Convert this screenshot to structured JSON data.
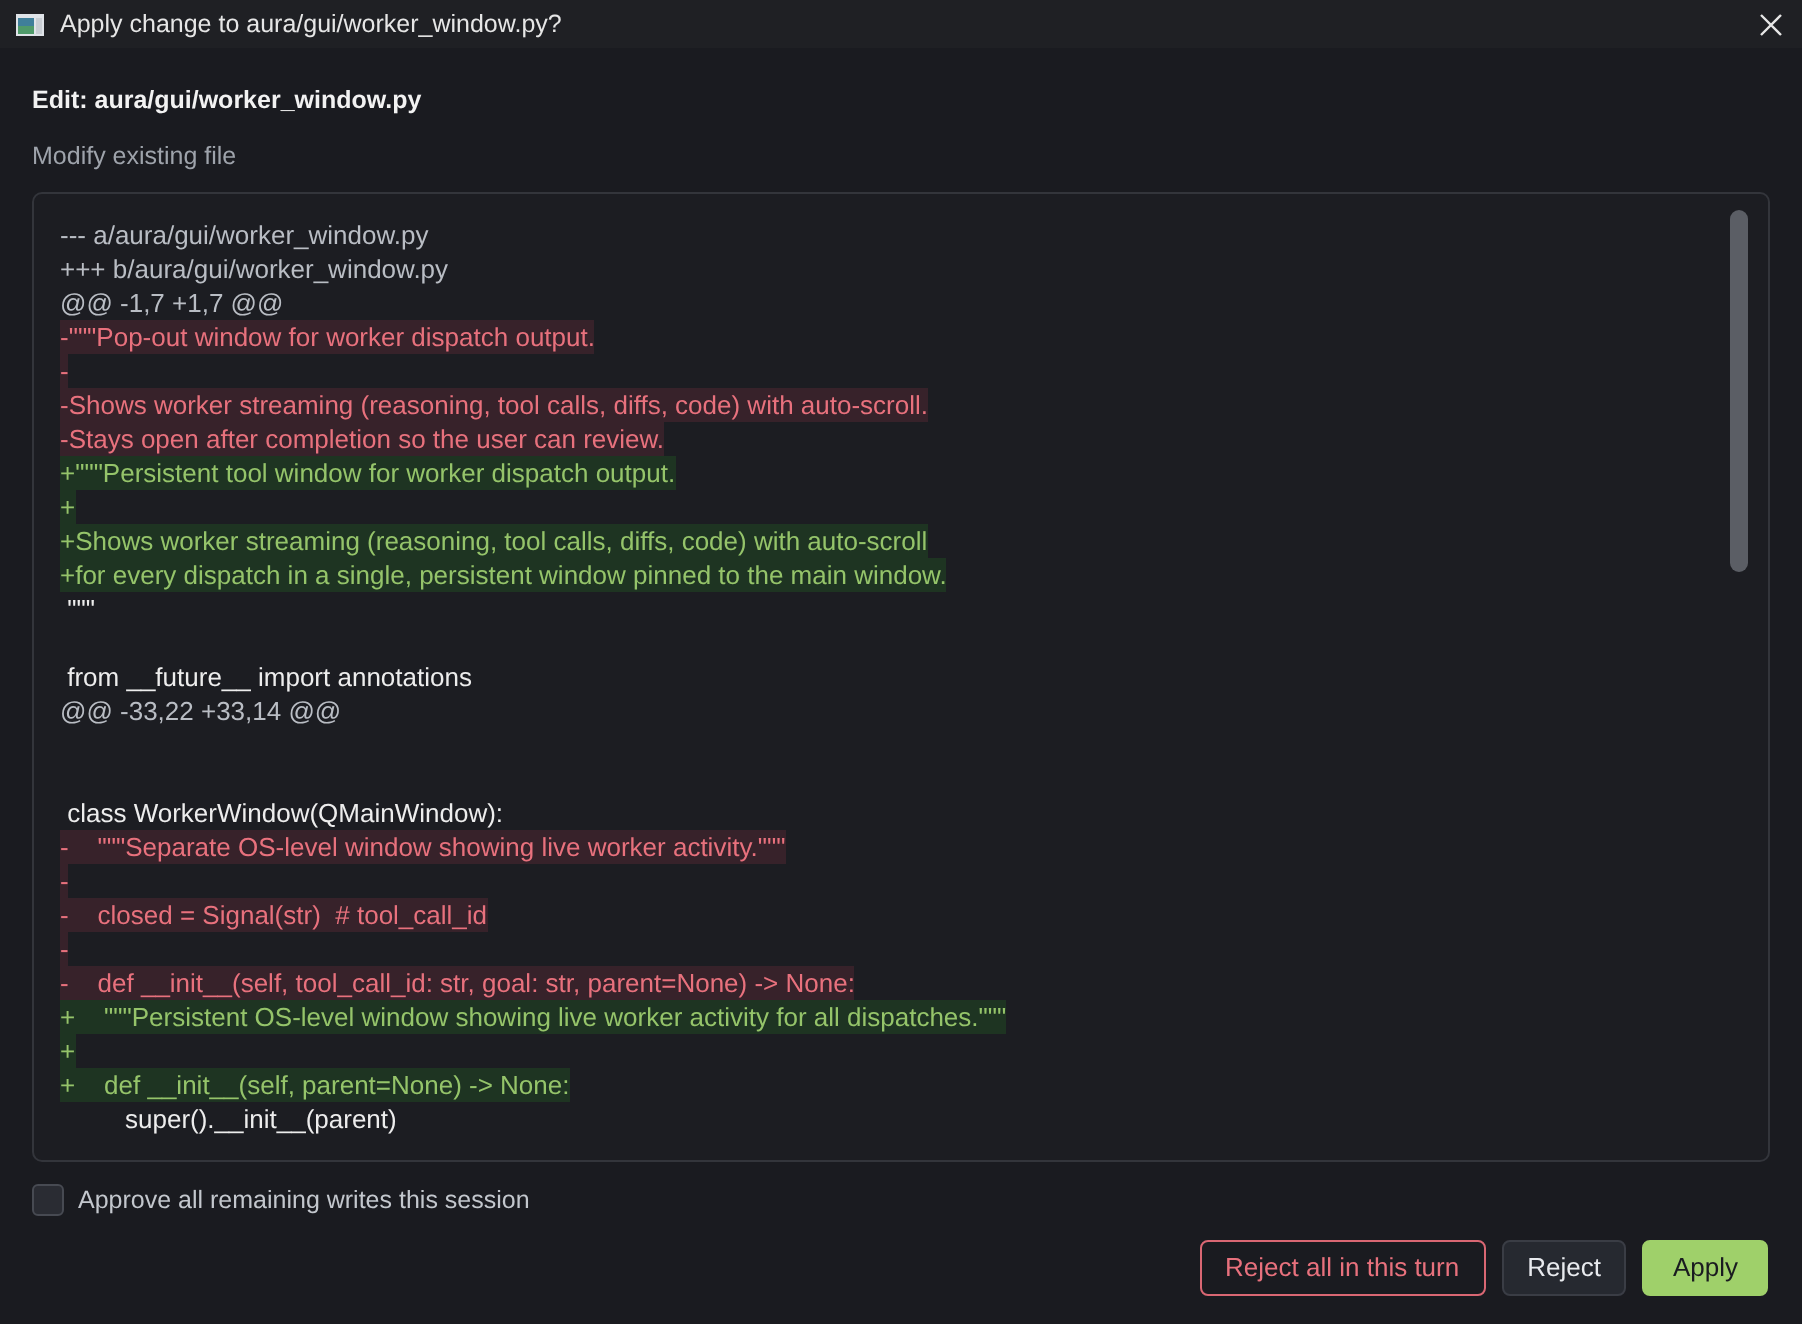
{
  "window": {
    "title": "Apply change to aura/gui/worker_window.py?"
  },
  "heading": "Edit: aura/gui/worker_window.py",
  "subheading": "Modify existing file",
  "diff": {
    "lines": [
      {
        "kind": "header",
        "text": "--- a/aura/gui/worker_window.py"
      },
      {
        "kind": "header",
        "text": "+++ b/aura/gui/worker_window.py"
      },
      {
        "kind": "hunk",
        "text": "@@ -1,7 +1,7 @@"
      },
      {
        "kind": "removed",
        "text": "-\"\"\"Pop-out window for worker dispatch output."
      },
      {
        "kind": "removed",
        "text": "-"
      },
      {
        "kind": "removed",
        "text": "-Shows worker streaming (reasoning, tool calls, diffs, code) with auto-scroll."
      },
      {
        "kind": "removed",
        "text": "-Stays open after completion so the user can review."
      },
      {
        "kind": "added",
        "text": "+\"\"\"Persistent tool window for worker dispatch output."
      },
      {
        "kind": "added",
        "text": "+"
      },
      {
        "kind": "added",
        "text": "+Shows worker streaming (reasoning, tool calls, diffs, code) with auto-scroll"
      },
      {
        "kind": "added",
        "text": "+for every dispatch in a single, persistent window pinned to the main window."
      },
      {
        "kind": "context",
        "text": " \"\"\""
      },
      {
        "kind": "blank"
      },
      {
        "kind": "context",
        "text": " from __future__ import annotations"
      },
      {
        "kind": "hunk",
        "text": "@@ -33,22 +33,14 @@"
      },
      {
        "kind": "blank"
      },
      {
        "kind": "blank"
      },
      {
        "kind": "context",
        "text": " class WorkerWindow(QMainWindow):"
      },
      {
        "kind": "removed",
        "text": "-    \"\"\"Separate OS-level window showing live worker activity.\"\"\""
      },
      {
        "kind": "removed",
        "text": "-"
      },
      {
        "kind": "removed",
        "text": "-    closed = Signal(str)  # tool_call_id"
      },
      {
        "kind": "removed",
        "text": "-"
      },
      {
        "kind": "removed",
        "text": "-    def __init__(self, tool_call_id: str, goal: str, parent=None) -> None:"
      },
      {
        "kind": "added",
        "text": "+    \"\"\"Persistent OS-level window showing live worker activity for all dispatches.\"\"\""
      },
      {
        "kind": "added",
        "text": "+"
      },
      {
        "kind": "added",
        "text": "+    def __init__(self, parent=None) -> None:"
      },
      {
        "kind": "context",
        "text": "         super().__init__(parent)"
      }
    ]
  },
  "approve_all": {
    "label": "Approve all remaining writes this session",
    "checked": false
  },
  "buttons": [
    {
      "kind": "danger",
      "label": "Reject all in this turn"
    },
    {
      "kind": "secondary",
      "label": "Reject"
    },
    {
      "kind": "primary",
      "label": "Apply"
    }
  ]
}
